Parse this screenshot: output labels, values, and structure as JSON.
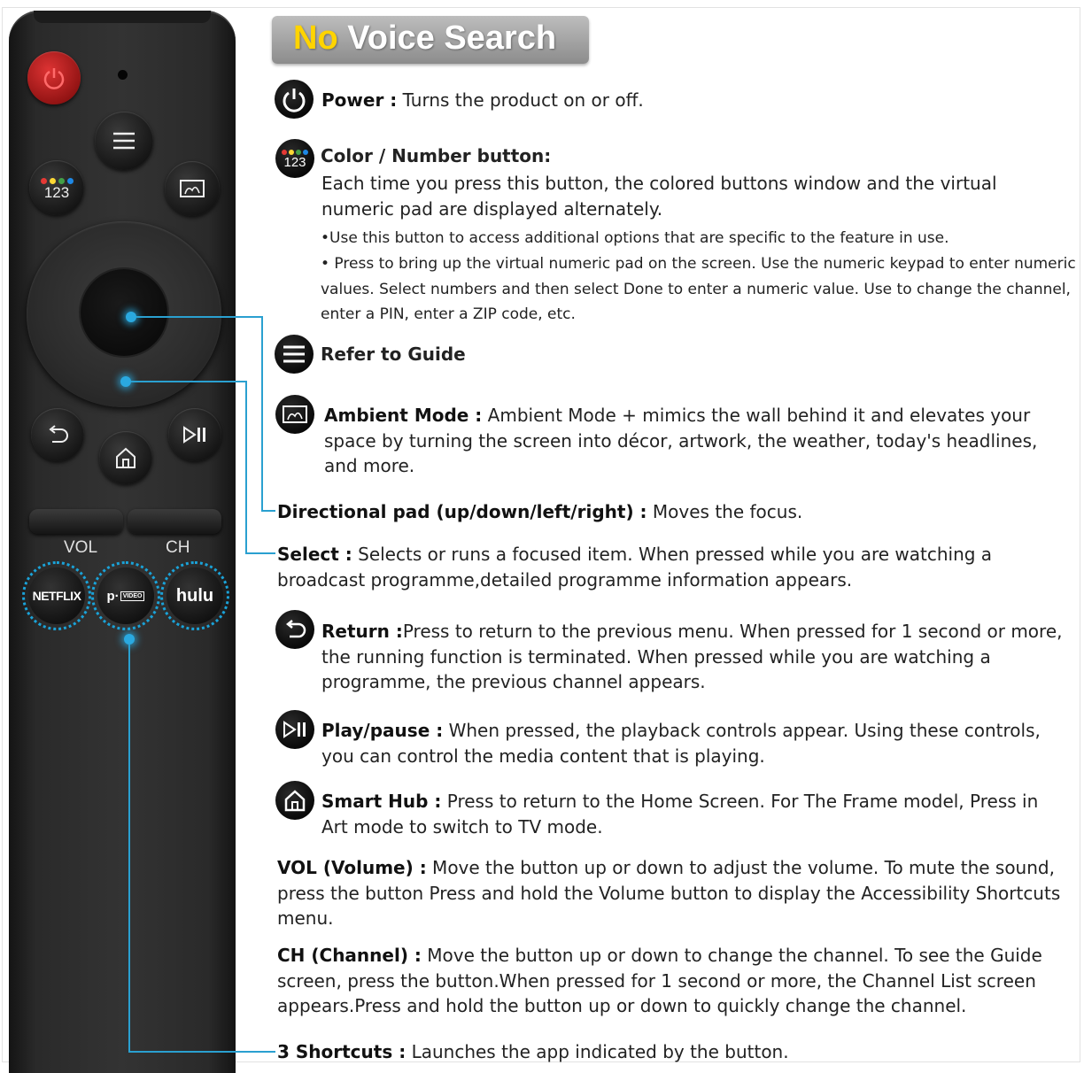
{
  "banner": {
    "highlight": "No",
    "rest": " Voice Search"
  },
  "remote": {
    "num_label": "123",
    "vol_label": "VOL",
    "ch_label": "CH",
    "apps": [
      "NETFLIX",
      "p·",
      "VIDEO",
      "hulu"
    ],
    "color_dots": [
      "#e53935",
      "#fdd835",
      "#43a047",
      "#1e88e5"
    ]
  },
  "items": {
    "power": {
      "title": "Power :",
      "desc": " Turns the product on or off."
    },
    "color": {
      "icon_label": "123",
      "title": "Color / Number button:",
      "desc": "Each time you press this button, the colored buttons window and the virtual numeric pad are displayed alternately.",
      "bullet1": "•Use this button to access additional options that are specific to the feature in use.",
      "bullet2": "• Press to bring up the virtual numeric pad on the screen. Use the numeric keypad to enter numeric values. Select numbers and then select Done to enter a numeric value. Use to change the channel, enter a PIN, enter a ZIP code, etc."
    },
    "guide": {
      "title": "Refer to Guide"
    },
    "ambient": {
      "title": "Ambient Mode :",
      "desc": " Ambient Mode + mimics the wall behind it and elevates your space by turning the screen into décor, artwork, the weather, today's headlines, and more."
    },
    "dpad": {
      "title": "Directional pad (up/down/left/right) :",
      "desc": " Moves the focus."
    },
    "select": {
      "title": "Select :",
      "desc": " Selects or runs a focused item. When pressed while you are watching a broadcast programme,detailed programme information appears."
    },
    "return": {
      "title": "Return :",
      "desc": "Press to return to the previous menu. When pressed for 1 second or more, the running function is terminated. When pressed while you are watching a programme, the previous channel appears."
    },
    "play": {
      "title": "Play/pause :",
      "desc": " When pressed, the playback controls appear. Using these controls, you can control the media content that is playing."
    },
    "hub": {
      "title": "Smart Hub :",
      "desc": " Press to return to the Home Screen. For The Frame model, Press in Art mode to switch to TV mode."
    },
    "vol": {
      "title": "VOL (Volume) :",
      "desc": " Move the button up or down to adjust the volume. To mute the sound, press the button Press and hold the Volume button to display the Accessibility Shortcuts menu."
    },
    "ch": {
      "title": "CH (Channel) :",
      "desc": " Move the button up or down to change the channel. To see the Guide screen, press the button.When pressed for 1 second or more, the Channel List screen appears.Press and hold the button up or down to quickly change the channel."
    },
    "shortcuts": {
      "title": "3 Shortcuts :",
      "desc": " Launches the app indicated by the button."
    }
  },
  "colors": {
    "accent_line": "#2aa0d0",
    "banner_highlight": "#ffd400",
    "power_red": "#c62828"
  }
}
